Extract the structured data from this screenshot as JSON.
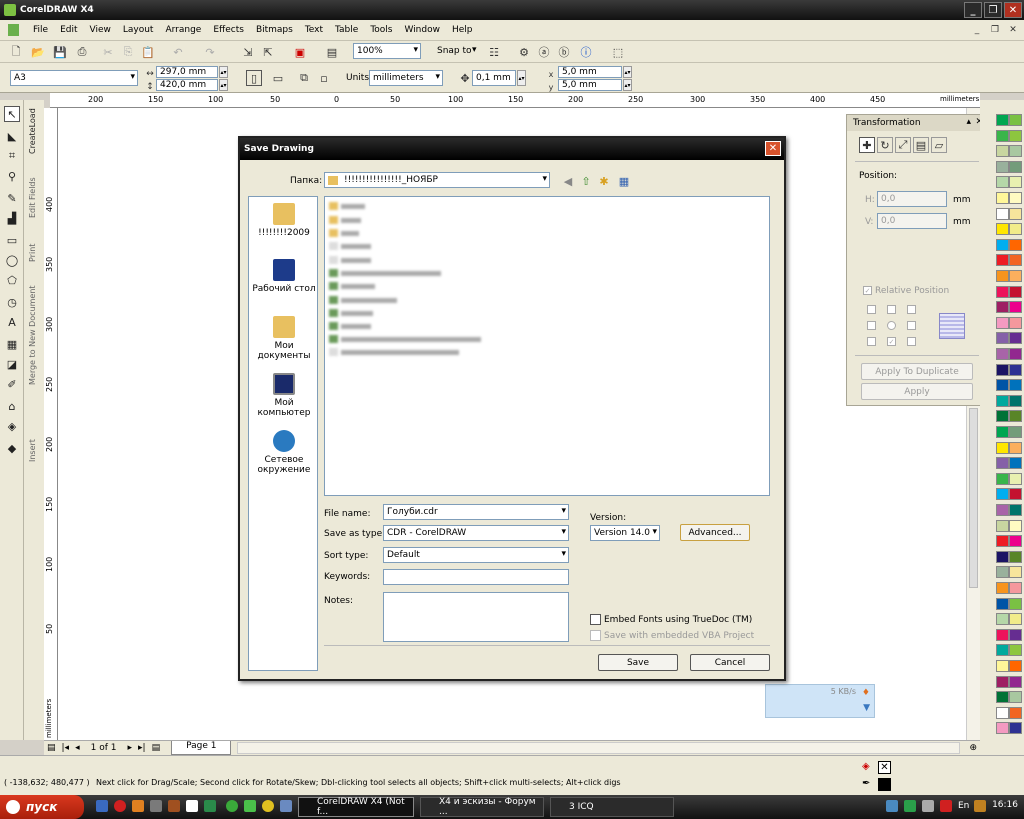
{
  "window": {
    "title": "CorelDRAW X4"
  },
  "menu": [
    "File",
    "Edit",
    "View",
    "Layout",
    "Arrange",
    "Effects",
    "Bitmaps",
    "Text",
    "Table",
    "Tools",
    "Window",
    "Help"
  ],
  "toolbar": {
    "zoom": "100%",
    "snap_to": "Snap to",
    "page_size": "A3",
    "width": "297,0 mm",
    "height": "420,0 mm",
    "units_label": "Units:",
    "units": "millimeters",
    "nudge": "0,1 mm",
    "dup_x": "5,0 mm",
    "dup_y": "5,0 mm"
  },
  "ruler": {
    "h_ticks": [
      "200",
      "150",
      "100",
      "50",
      "0",
      "50",
      "100",
      "150",
      "200",
      "250",
      "300",
      "350",
      "400",
      "450"
    ],
    "h_unit": "millimeters",
    "v_ticks": [
      "400",
      "350",
      "300",
      "250",
      "200",
      "150",
      "100",
      "50"
    ],
    "v_unit": "millimeters"
  },
  "docker_tabs": [
    "CreateLoad",
    "Edit Fields",
    "Print",
    "Merge to New Document",
    "Insert"
  ],
  "transformation": {
    "title": "Transformation",
    "position_label": "Position:",
    "h_value": "0,0",
    "v_value": "0,0",
    "unit": "mm",
    "h_label": "H:",
    "v_label": "V:",
    "relative_position": "Relative Position",
    "apply_dup": "Apply To Duplicate",
    "apply": "Apply"
  },
  "popup": {
    "speed": "5 KB/s"
  },
  "dialog": {
    "title": "Save Drawing",
    "folder_label": "Папка:",
    "folder": "!!!!!!!!!!!!!!!!_НОЯБР",
    "places": [
      "!!!!!!!!2009",
      "Рабочий стол",
      "Мои документы",
      "Мой компьютер",
      "Сетевое окружение"
    ],
    "file_name_label": "File name:",
    "file_name": "Голуби.cdr",
    "save_as_label": "Save as type:",
    "save_as": "CDR - CorelDRAW",
    "sort_label": "Sort type:",
    "sort": "Default",
    "keywords_label": "Keywords:",
    "notes_label": "Notes:",
    "version_label": "Version:",
    "version": "Version 14.0",
    "advanced": "Advanced...",
    "embed_fonts": "Embed Fonts using TrueDoc (TM)",
    "vba": "Save with embedded VBA Project",
    "save": "Save",
    "cancel": "Cancel"
  },
  "page_nav": {
    "page_of": "1 of 1",
    "page_tab": "Page 1"
  },
  "status": {
    "coords": "( -138,632; 480,477 )",
    "hint": "Next click for Drag/Scale; Second click for Rotate/Skew; Dbl-clicking tool selects all objects; Shift+click multi-selects; Alt+click digs"
  },
  "taskbar": {
    "start": "пуск",
    "tasks": [
      "CorelDRAW X4 (Not f...",
      "X4 и эскизы - Форум ...",
      "3 ICQ"
    ],
    "lang": "En",
    "time": "16:16"
  },
  "palette_colors": [
    "#00a651",
    "#7ac143",
    "#39b54a",
    "#8dc63f",
    "#c8d6a0",
    "#a8c8a0",
    "#99b19c",
    "#739c7a",
    "#b5d7a8",
    "#e8f0b0",
    "#fff799",
    "#fffbc2",
    "#ffffff",
    "#f7e59c",
    "#ffe600",
    "#f1ec8a",
    "#00aeef",
    "#ff6600",
    "#ed1c24",
    "#f26522",
    "#f7941d",
    "#fbaf5d",
    "#ed145b",
    "#c4122f",
    "#9e1f63",
    "#ec008c",
    "#f49ac1",
    "#f5989d",
    "#8560a8",
    "#662d91",
    "#a864a8",
    "#92278f",
    "#1b1464",
    "#2e3192",
    "#0054a6",
    "#0072bc",
    "#00a99d",
    "#00746b",
    "#007236",
    "#598527"
  ]
}
